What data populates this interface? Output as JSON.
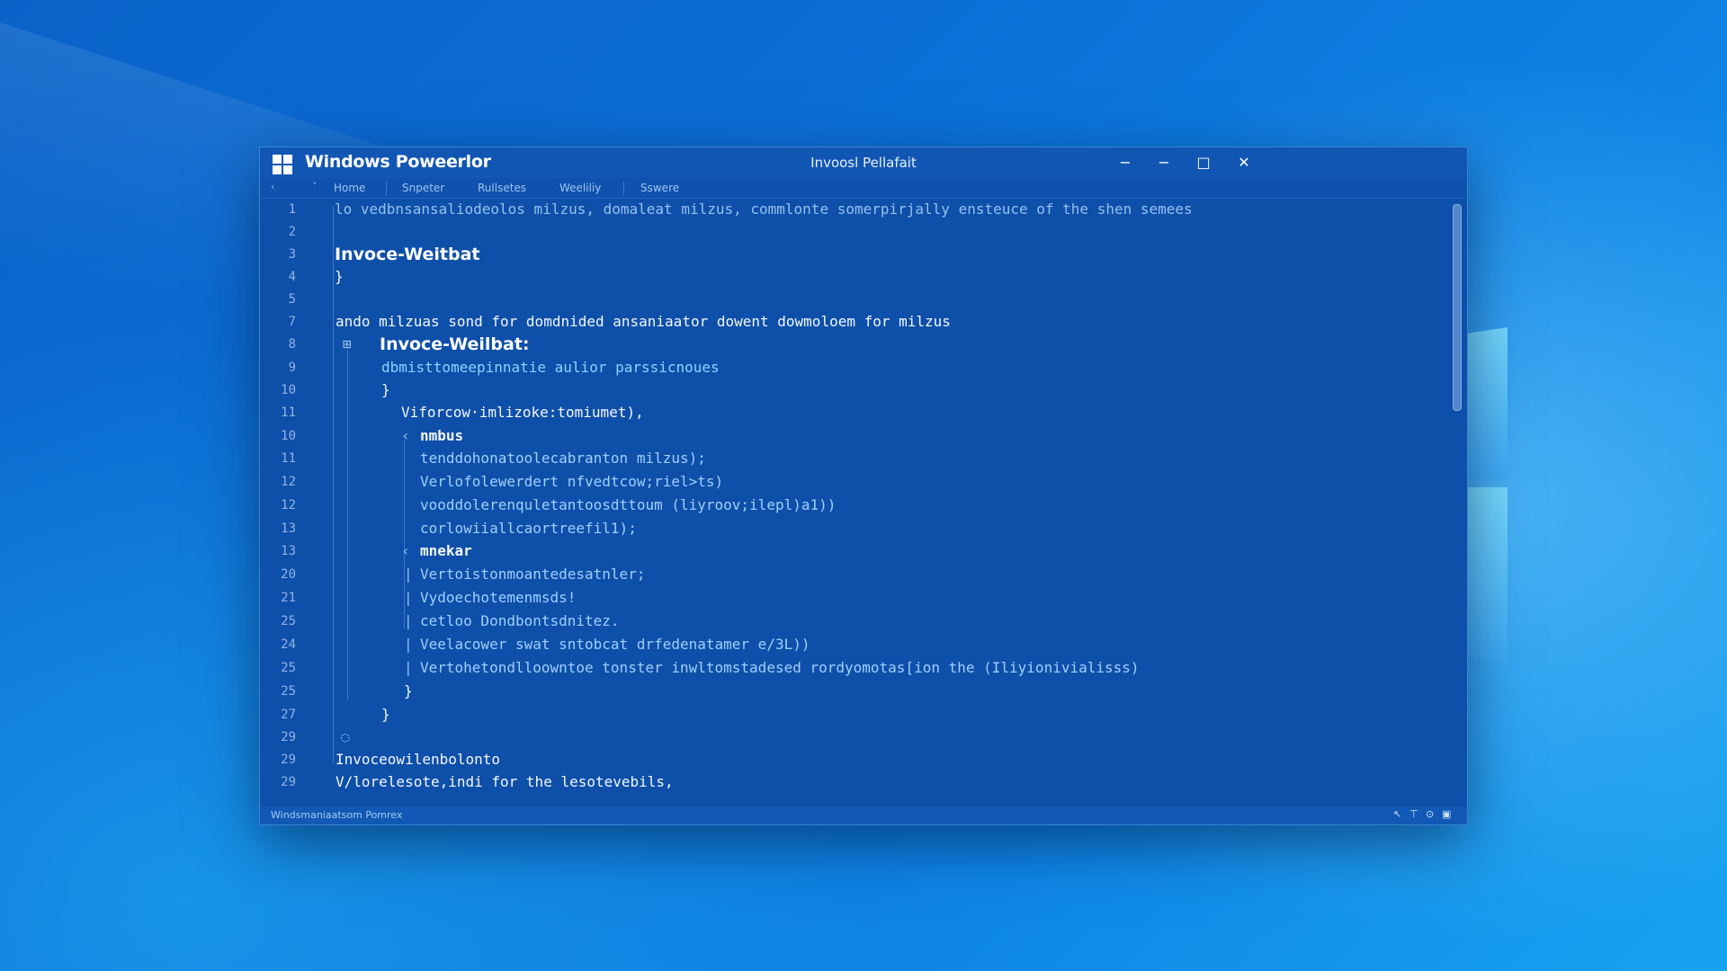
{
  "window": {
    "app_title": "Windows Poweerlor",
    "doc_title": "Invoosl Pellafait",
    "controls": {
      "minimize_alt": "−",
      "minimize": "−",
      "maximize": "□",
      "close": "✕"
    }
  },
  "tabs": [
    "Home",
    "Snpeter",
    "Rullsetes",
    "Weeliliy",
    "Sswere"
  ],
  "tab_arrows": [
    "‹",
    "˅"
  ],
  "editor": {
    "lines": [
      {
        "num": "1",
        "text": "lo vedbnsansaliodeolos milzus, domaleat milzus, commlonte somerpirjally ensteuce of the shen semees"
      },
      {
        "num": "2",
        "text": ""
      },
      {
        "num": "3",
        "text": "Invoce-Weitbat"
      },
      {
        "num": "4",
        "text": "}"
      },
      {
        "num": "5",
        "text": ""
      },
      {
        "num": "7",
        "text": "ando milzuas sond for domdnided ansaniaator dowent dowmoloem for milzus"
      },
      {
        "num": "8",
        "text": "Invoce-Weilbat:",
        "marker": "⊞"
      },
      {
        "num": "9",
        "text": "dbmisttomeepinnatie aulior parssicnoues"
      },
      {
        "num": "10",
        "text": "}"
      },
      {
        "num": "11",
        "text": "Viforcow·imlizoke:tomiumet),"
      },
      {
        "num": "10",
        "text": "nmbus",
        "marker": "‹"
      },
      {
        "num": "11",
        "text": "tenddohonatoolecabranton milzus);"
      },
      {
        "num": "12",
        "text": "Verlofolewerdert nfvedtcow;riel>ts)"
      },
      {
        "num": "12",
        "text": "vooddolerenquletantoosdttoum (liyroov;ilepl)a1))"
      },
      {
        "num": "13",
        "text": "corlowiiallcaortreefil1);"
      },
      {
        "num": "13",
        "text": "mnekar",
        "marker": "‹"
      },
      {
        "num": "20",
        "text": "Vertoistonmoantedesatnler;",
        "bar": "|"
      },
      {
        "num": "21",
        "text": "Vydoechotemenmsds!",
        "bar": "|"
      },
      {
        "num": "25",
        "text": "cetloo Dondbontsdnitez.",
        "bar": "|"
      },
      {
        "num": "24",
        "text": "Veelacower swat sntobcat drfedenatamer e/3L))",
        "bar": "|"
      },
      {
        "num": "25",
        "text": "Vertohetondlloowntoe tonster inwltomstadesed rordyomotas[ion the (Iliyionivialisss)",
        "bar": "|"
      },
      {
        "num": "25",
        "text": "}"
      },
      {
        "num": "27",
        "text": "}"
      },
      {
        "num": "29",
        "text": "",
        "marker": "◌"
      },
      {
        "num": "29",
        "text": "Invoceowilenbolonto"
      },
      {
        "num": "29",
        "text": "V/lorelesote,indi for the lesotevebils,"
      }
    ]
  },
  "status": {
    "text": "Windsmaniaatsom Pomrex",
    "icons": [
      "↖",
      "⊤",
      "⊙",
      "▣"
    ]
  }
}
